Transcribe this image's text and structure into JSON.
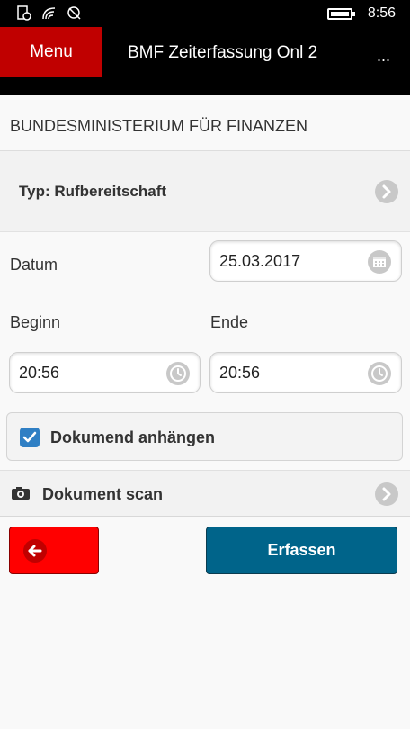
{
  "status_bar": {
    "time": "8:56"
  },
  "app_bar": {
    "menu_label": "Menu",
    "title": "BMF Zeiterfassung Onl 2",
    "more_label": "..."
  },
  "ministry": {
    "name": "BUNDESMINISTERIUM FÜR FINANZEN"
  },
  "type_row": {
    "label": "Typ: Rufbereitschaft"
  },
  "form": {
    "date_label": "Datum",
    "date_value": "25.03.2017",
    "start_label": "Beginn",
    "end_label": "Ende",
    "start_value": "20:56",
    "end_value": "20:56"
  },
  "attach": {
    "label": "Dokumend anhängen",
    "checked": true
  },
  "scan": {
    "label": "Dokument scan"
  },
  "actions": {
    "submit_label": "Erfassen"
  },
  "colors": {
    "menu": "#c00000",
    "back": "#ff0000",
    "submit": "#00648a",
    "checkbox": "#2f7fc4"
  },
  "icons": {
    "date": "calendar-icon",
    "time": "clock-icon",
    "chevron": "chevron-right-icon",
    "camera": "camera-icon",
    "back": "back-arrow-icon"
  }
}
